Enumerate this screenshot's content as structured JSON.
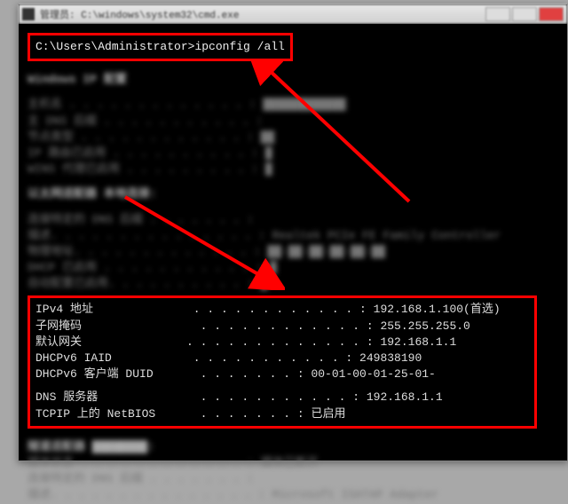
{
  "titlebar": {
    "title": "管理员: C:\\windows\\system32\\cmd.exe"
  },
  "terminal": {
    "prompt": "C:\\Users\\Administrator>",
    "command": "ipconfig /all",
    "blurred_header_1": "Windows IP 配置",
    "blurred_block_1_lines": [
      "主机名 . . . . . . . . . . . . . : ████████████",
      "主 DNS 后缀 . . . . . . . . . . . :",
      "节点类型  . . . . . . . . . . . . : ██",
      "IP 路由已启用 . . . . . . . . . . : █",
      "WINS 代理已启用 . . . . . . . . . : █"
    ],
    "blurred_header_2": "以太网适配器 本地连接:",
    "blurred_block_2_lines": [
      "连接特定的 DNS 后缀 . . . . . . . :",
      "描述. . . . . . . . . . . . . . . : Realtek PCIe FE Family Controller",
      "物理地址. . . . . . . . . . . . . : ██-██-██-██-██-██",
      "DHCP 已启用 . . . . . . . . . . . : █",
      "自动配置已启用. . . . . . . . . . : █"
    ],
    "details": {
      "ipv4_label": "IPv4 地址",
      "ipv4_value": "192.168.1.100(首选)",
      "subnet_label": "子网掩码",
      "subnet_value": "255.255.255.0",
      "gateway_label": "默认网关",
      "gateway_value": "192.168.1.1",
      "iaid_label": "DHCPv6 IAID",
      "iaid_value": "249838190",
      "duid_label": "DHCPv6 客户端 DUID",
      "duid_value": "00-01-00-01-25-01-",
      "dns_label": "DNS 服务器",
      "dns_value": "192.168.1.1",
      "netbios_label": "TCPIP 上的 NetBIOS",
      "netbios_value": "已启用"
    },
    "blurred_footer_lines": [
      "隧道适配器 ████████:",
      "",
      "媒体状态  . . . . . . . . . . . . : 媒体已断开",
      "连接特定的 DNS 后缀 . . . . . . . :",
      "描述. . . . . . . . . . . . . . . : Microsoft ISATAP Adapter"
    ]
  },
  "colors": {
    "highlight": "#ff0000",
    "terminal_bg": "#000000",
    "terminal_fg": "#dddddd"
  }
}
